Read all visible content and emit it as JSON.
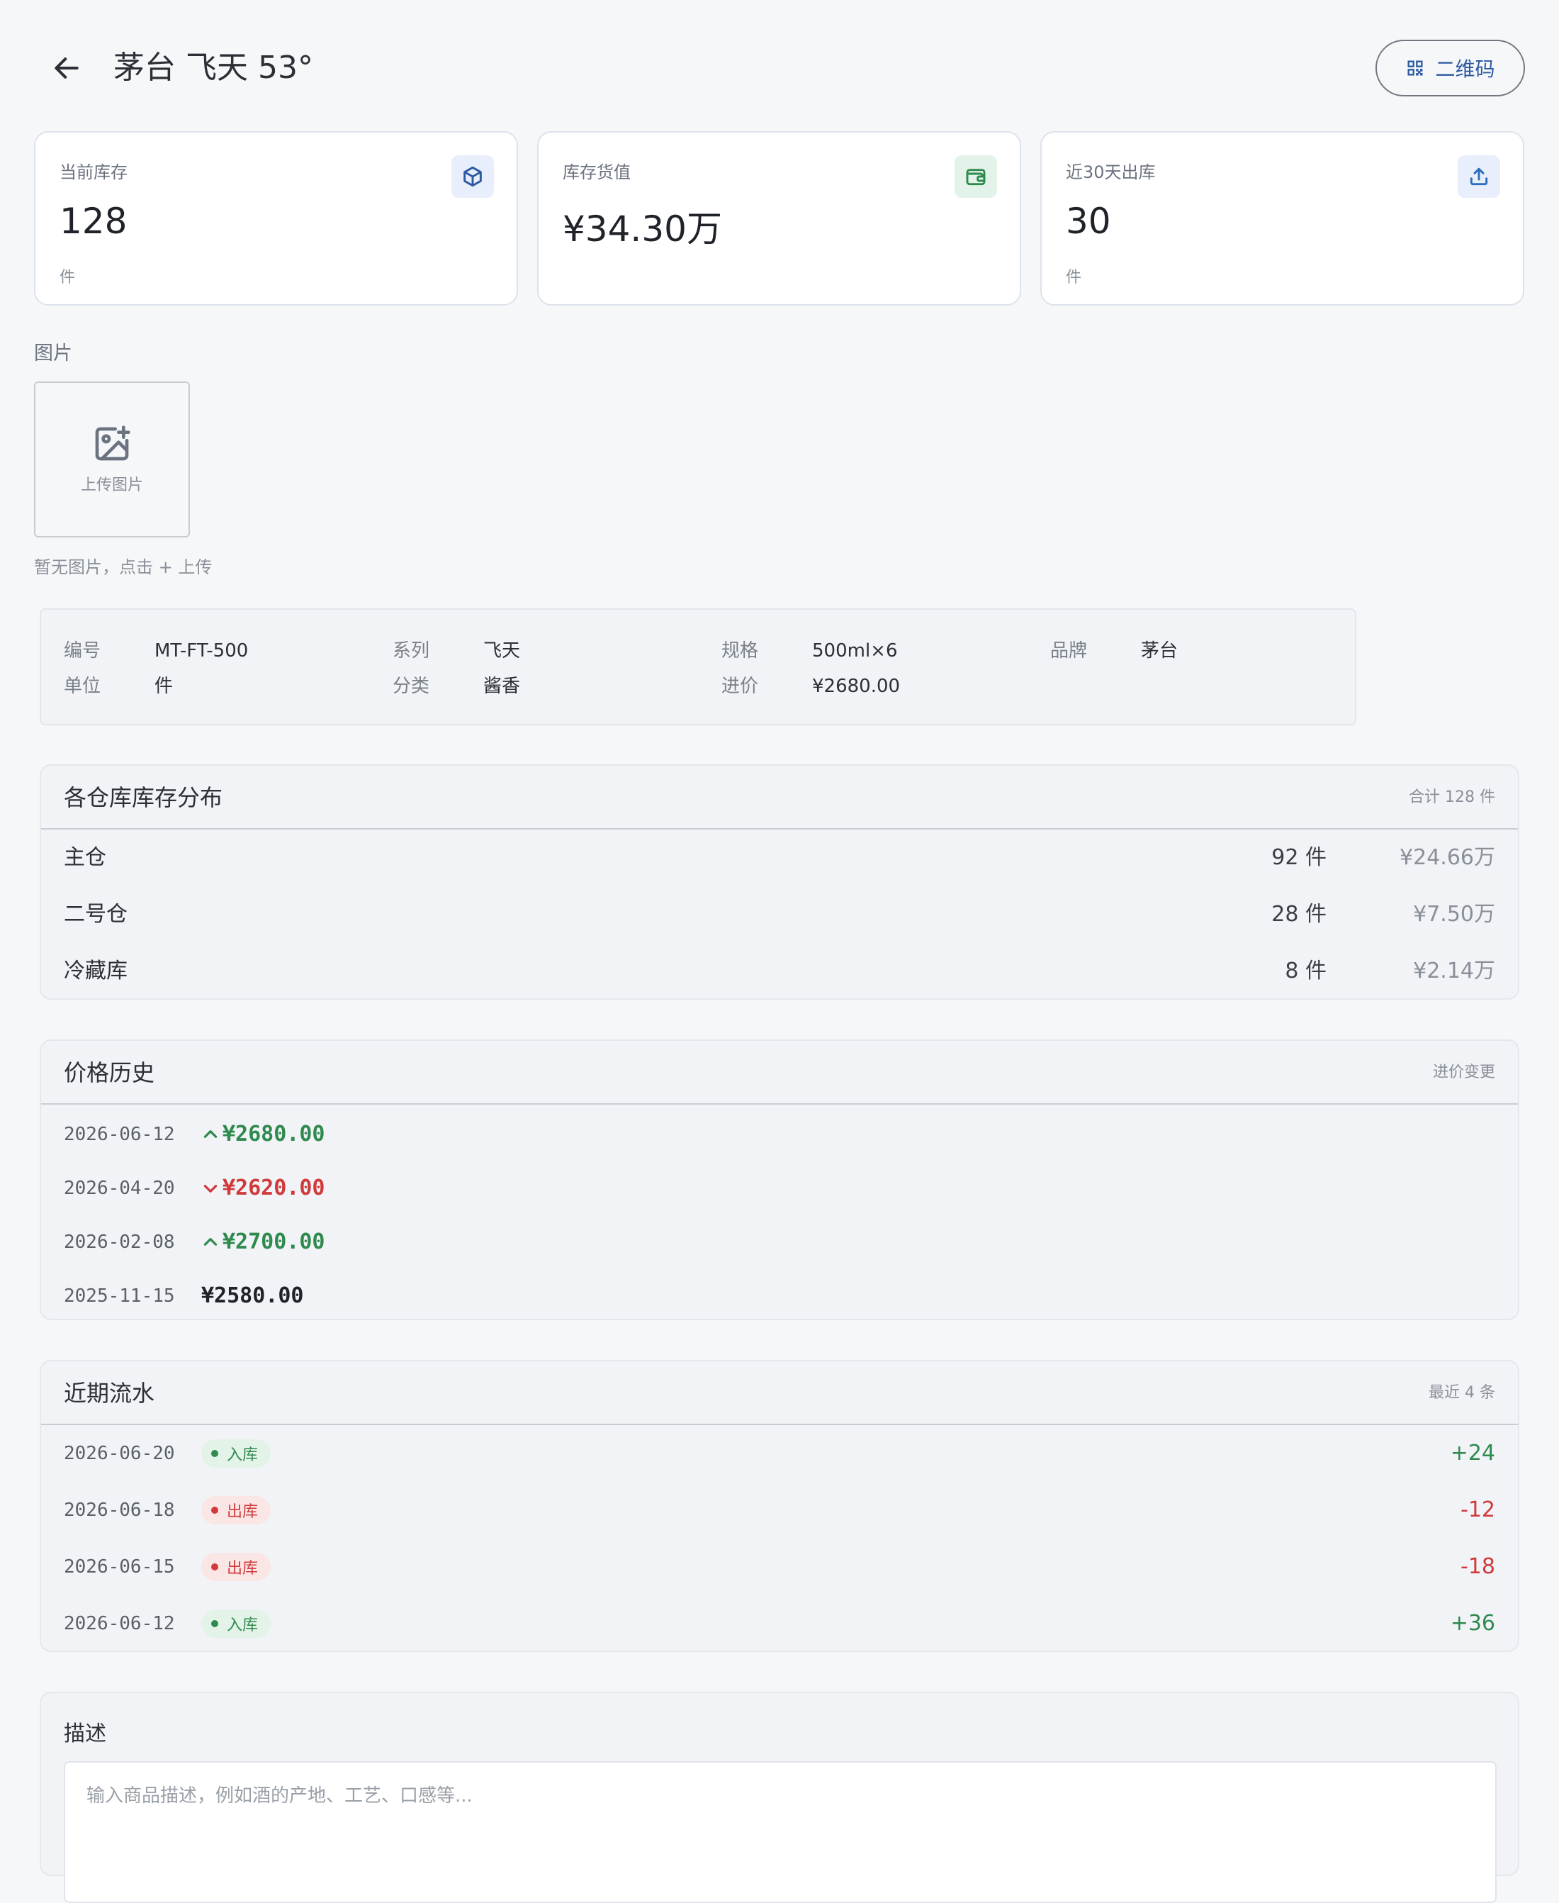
{
  "header": {
    "title": "茅台 飞天 53°",
    "qr_label": "二维码"
  },
  "stats": [
    {
      "label": "当前库存",
      "value": "128",
      "unit": "件",
      "icon": "box-icon",
      "badge_bg": "#e8eefb",
      "icon_color": "#2c5aa0"
    },
    {
      "label": "库存货值",
      "value": "¥34.30万",
      "unit": "",
      "icon": "wallet-icon",
      "badge_bg": "#e4f3ea",
      "icon_color": "#2f8a4e"
    },
    {
      "label": "近30天出库",
      "value": "30",
      "unit": "件",
      "icon": "upload-icon",
      "badge_bg": "#e8eefb",
      "icon_color": "#2c6fbf"
    }
  ],
  "images": {
    "section_label": "图片",
    "upload_label": "上传图片",
    "empty_hint": "暂无图片，点击 + 上传"
  },
  "info": {
    "code_label": "编号",
    "code": "MT-FT-500",
    "series_label": "系列",
    "series": "飞天",
    "spec_label": "规格",
    "spec": "500ml×6",
    "brand_label": "品牌",
    "brand": "茅台",
    "unit_label": "单位",
    "unit": "件",
    "category_label": "分类",
    "category": "酱香",
    "cost_label": "进价",
    "cost": "¥2680.00"
  },
  "warehouses": {
    "title": "各仓库库存分布",
    "total": "合计 128 件",
    "rows": [
      {
        "name": "主仓",
        "qty": "92 件",
        "value": "¥24.66万"
      },
      {
        "name": "二号仓",
        "qty": "28 件",
        "value": "¥7.50万"
      },
      {
        "name": "冷藏库",
        "qty": "8 件",
        "value": "¥2.14万"
      }
    ]
  },
  "price_history": {
    "title": "价格历史",
    "meta": "进价变更",
    "rows": [
      {
        "date": "2026-06-12",
        "price": "¥2680.00",
        "trend": "up"
      },
      {
        "date": "2026-04-20",
        "price": "¥2620.00",
        "trend": "down"
      },
      {
        "date": "2026-02-08",
        "price": "¥2700.00",
        "trend": "up"
      },
      {
        "date": "2025-11-15",
        "price": "¥2580.00",
        "trend": "none"
      }
    ]
  },
  "flow": {
    "title": "近期流水",
    "meta": "最近 4 条",
    "rows": [
      {
        "date": "2026-06-20",
        "type": "入库",
        "kind": "in",
        "qty": "+24"
      },
      {
        "date": "2026-06-18",
        "type": "出库",
        "kind": "out",
        "qty": "-12"
      },
      {
        "date": "2026-06-15",
        "type": "出库",
        "kind": "out",
        "qty": "-18"
      },
      {
        "date": "2026-06-12",
        "type": "入库",
        "kind": "in",
        "qty": "+36"
      }
    ]
  },
  "description": {
    "title": "描述",
    "placeholder": "输入商品描述，例如酒的产地、工艺、口感等..."
  },
  "colors": {
    "up": "#2f8a4e",
    "down": "#d03a3a",
    "neutral": "#1f2329",
    "in_bg": "#e3f3e8",
    "out_bg": "#fbe6e6"
  }
}
